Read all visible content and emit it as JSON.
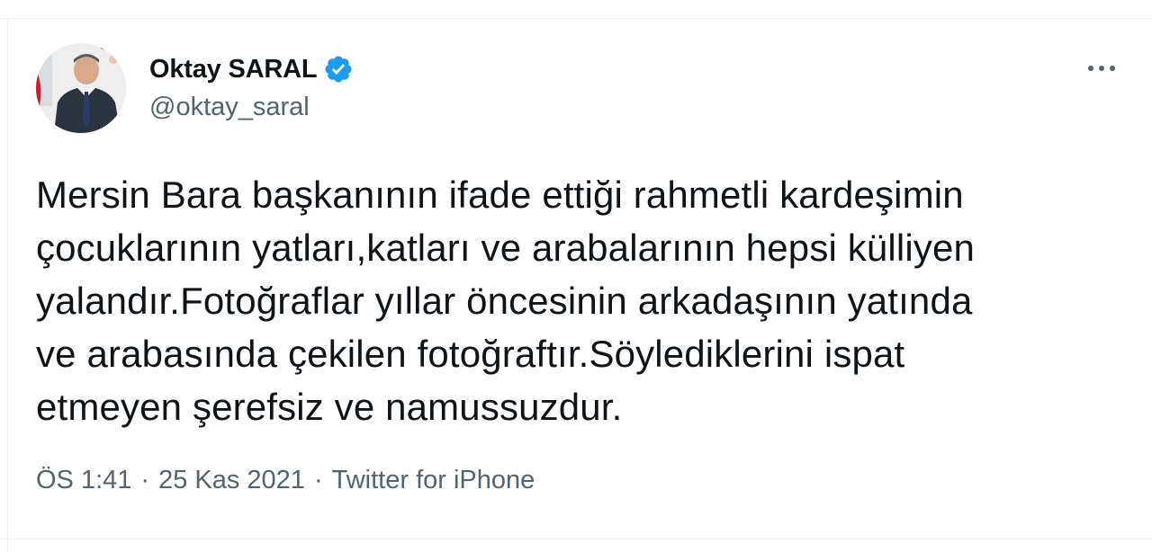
{
  "tweet": {
    "author": {
      "display_name": "Oktay SARAL",
      "handle": "@oktay_saral",
      "verified": true
    },
    "text": "Mersin Bara başkanının ifade ettiği rahmetli kardeşimin\nçocuklarının yatları,katları ve arabalarının hepsi külliyen\nyalandır.Fotoğraflar yıllar öncesinin arkadaşının yatında\nve arabasında çekilen fotoğraftır.Söylediklerini ispat\netmeyen şerefsiz ve namussuzdur.",
    "meta": {
      "time": "ÖS 1:41",
      "separator": "·",
      "date": "25 Kas 2021",
      "source": "Twitter for iPhone"
    }
  },
  "icons": {
    "verified": "verified-badge-icon",
    "more": "more-options-icon"
  },
  "colors": {
    "text_primary": "#0f1419",
    "text_secondary": "#536471",
    "verified_blue": "#1d9bf0",
    "divider": "#eff3f4"
  }
}
